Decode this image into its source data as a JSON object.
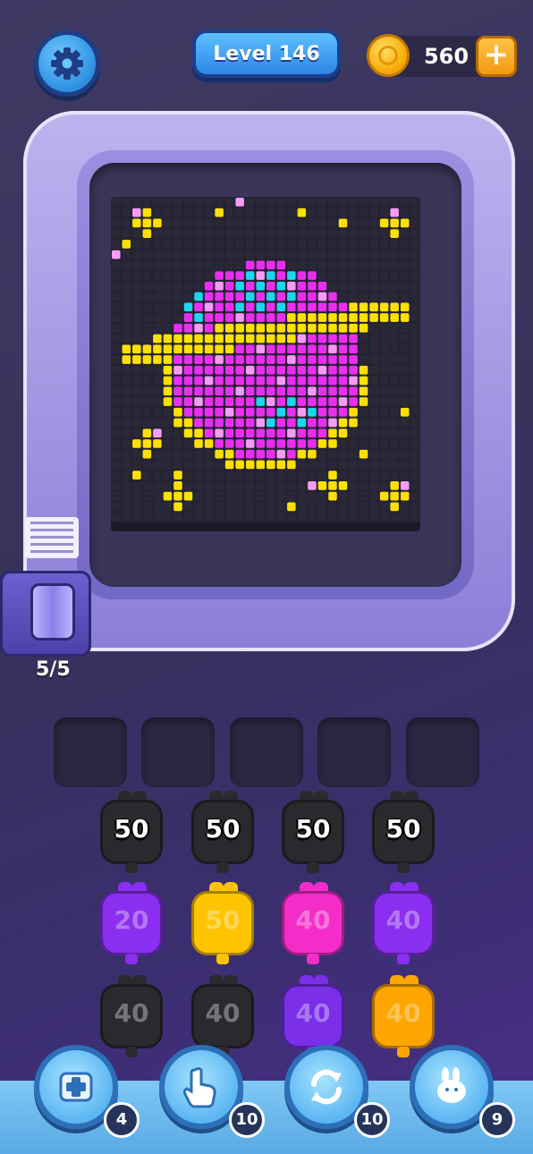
{
  "header": {
    "level_label": "Level 146",
    "coins": "560",
    "add_symbol": "+"
  },
  "board": {
    "roll_counter": "5/5",
    "palette": {
      "background": "#2a2836",
      "yellow": "#ffe100",
      "magenta": "#ea2ef0",
      "light_pink": "#f79bf7",
      "cyan": "#1ad7ef"
    }
  },
  "slots": {
    "count": 5
  },
  "cartridges": {
    "rows": [
      [
        {
          "value": "50",
          "color": "#2a2a2e",
          "state": "active"
        },
        {
          "value": "50",
          "color": "#2a2a2e",
          "state": "active"
        },
        {
          "value": "50",
          "color": "#2a2a2e",
          "state": "active"
        },
        {
          "value": "50",
          "color": "#2a2a2e",
          "state": "active"
        }
      ],
      [
        {
          "value": "20",
          "color": "#8a2ef0",
          "state": "dim"
        },
        {
          "value": "50",
          "color": "#ffc400",
          "state": "dim"
        },
        {
          "value": "40",
          "color": "#f42dc8",
          "state": "dim"
        },
        {
          "value": "40",
          "color": "#8a2ef0",
          "state": "dim"
        }
      ],
      [
        {
          "value": "40",
          "color": "#2a2a2e",
          "state": "dim"
        },
        {
          "value": "40",
          "color": "#2a2a2e",
          "state": "dim"
        },
        {
          "value": "40",
          "color": "#7a2ee8",
          "state": "dim"
        },
        {
          "value": "40",
          "color": "#ffa500",
          "state": "dim"
        }
      ]
    ]
  },
  "powerups": [
    {
      "name": "add-slot",
      "icon": "add-tape-icon",
      "count": "4"
    },
    {
      "name": "pick",
      "icon": "pointing-hand-icon",
      "count": "10"
    },
    {
      "name": "shuffle",
      "icon": "shuffle-icon",
      "count": "10"
    },
    {
      "name": "magic",
      "icon": "bunny-icon",
      "count": "9"
    }
  ]
}
